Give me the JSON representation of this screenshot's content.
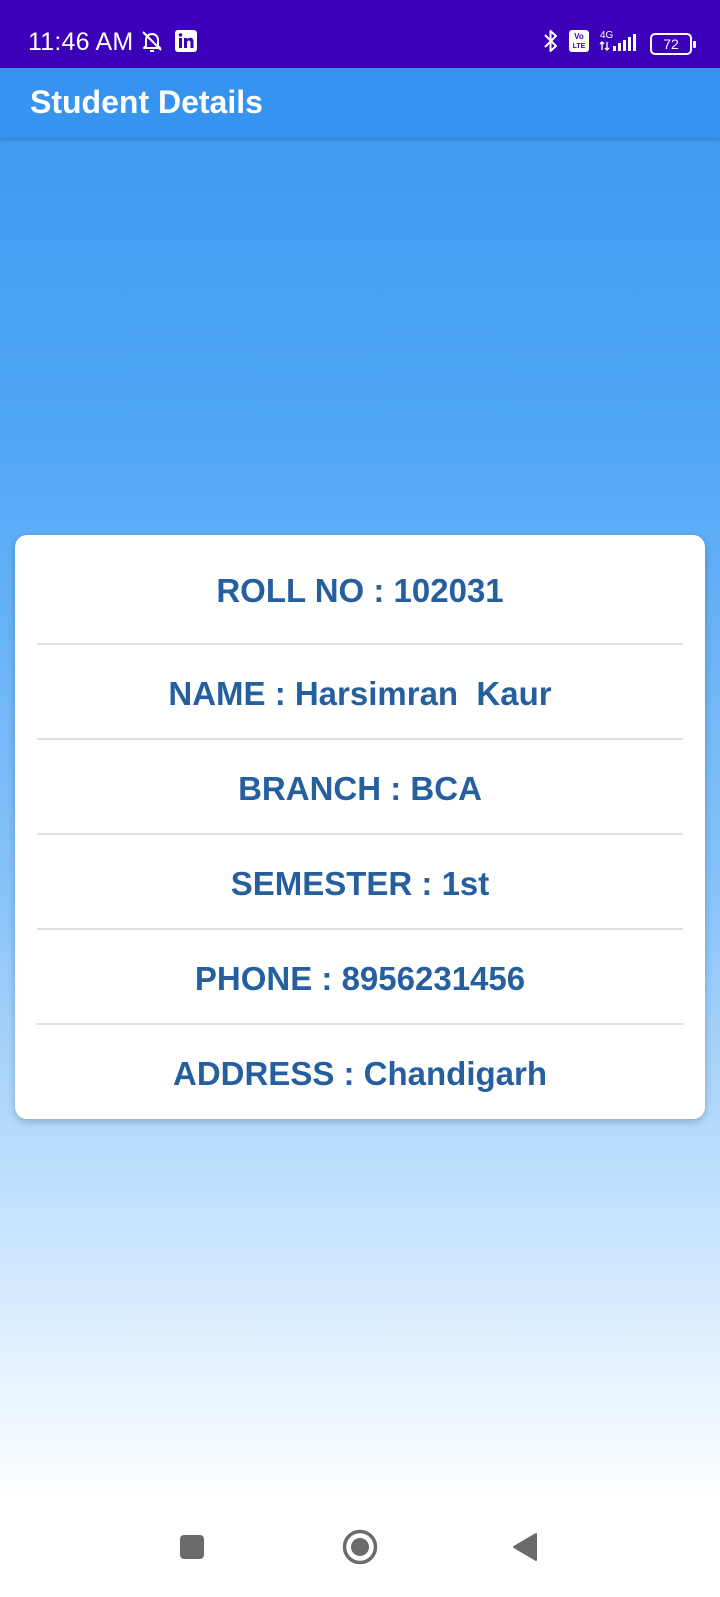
{
  "status_bar": {
    "time": "11:46 AM",
    "network": "4G",
    "volte": "Vo LTE",
    "battery": "72"
  },
  "app_bar": {
    "title": "Student Details"
  },
  "details": [
    "ROLL NO : 102031",
    "NAME : Harsimran  Kaur",
    "BRANCH : BCA",
    "SEMESTER : 1st",
    "PHONE : 8956231456",
    "ADDRESS : Chandigarh"
  ],
  "colors": {
    "status_bar": "#3b00b8",
    "app_bar": "#3793f0",
    "detail_text": "#265f9e",
    "card": "#ffffff"
  },
  "icons": {
    "status_left": [
      "notifications-off-icon",
      "linkedin-icon"
    ],
    "status_right": [
      "bluetooth-icon",
      "volte-icon",
      "signal-4g-icon",
      "battery-icon"
    ],
    "nav": [
      "recents-square-icon",
      "home-circle-icon",
      "back-triangle-icon"
    ]
  }
}
